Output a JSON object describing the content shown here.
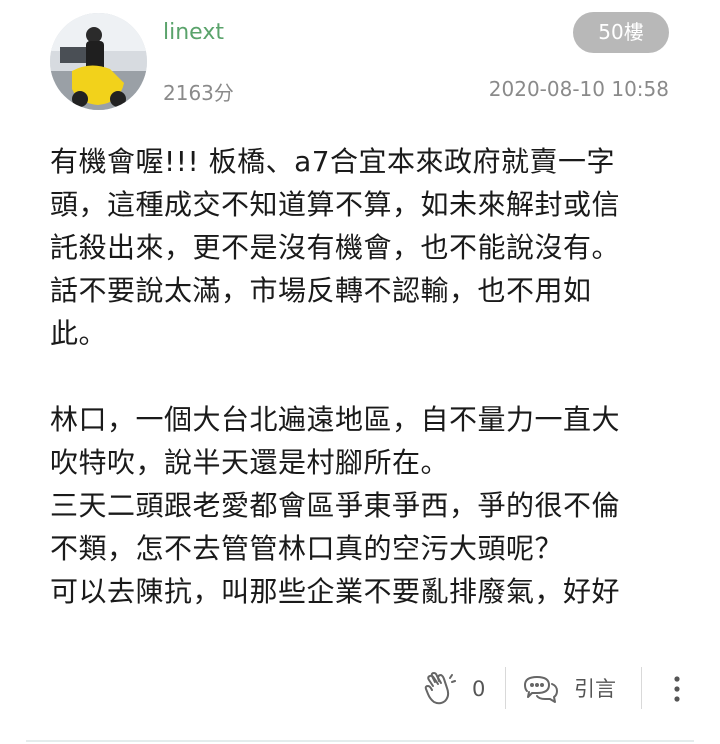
{
  "post": {
    "username": "linext",
    "score": "2163分",
    "floor": "50樓",
    "timestamp": "2020-08-10 10:58",
    "paragraphs": [
      "有機會喔!!! 板橋、a7合宜本來政府就賣一字\n頭，這種成交不知道算不算，如未來解封或信\n託殺出來，更不是沒有機會，也不能說沒有。\n話不要說太滿，市場反轉不認輸，也不用如\n此。",
      "林口，一個大台北遍遠地區，自不量力一直大\n吹特吹，說半天還是村腳所在。\n三天二頭跟老愛都會區爭東爭西，爭的很不倫\n不類，怎不去管管林口真的空污大頭呢？\n可以去陳抗，叫那些企業不要亂排廢氣，好好"
    ]
  },
  "actions": {
    "clap_icon": "clap-hands-icon",
    "clap_count": "0",
    "quote_icon": "chat-bubbles-icon",
    "quote_label": "引言",
    "more_icon": "vertical-dots-icon"
  },
  "colors": {
    "username": "#5aa36b",
    "meta_gray": "#8a8a8a",
    "badge_bg": "#b8b8b8"
  }
}
